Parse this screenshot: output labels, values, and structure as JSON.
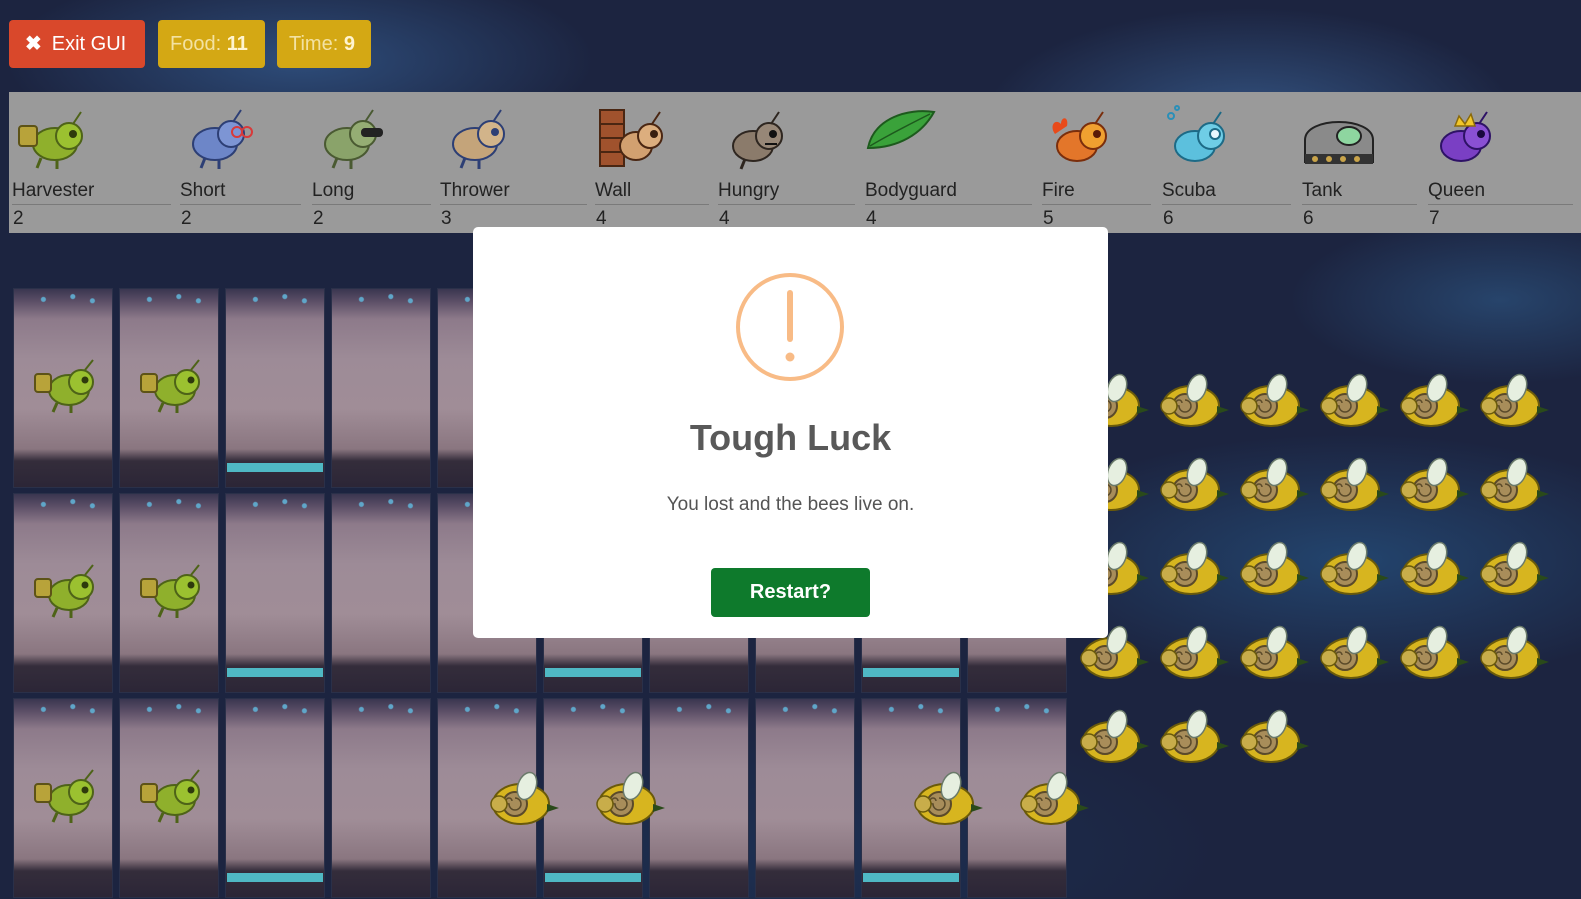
{
  "top_bar": {
    "exit_label": "Exit GUI",
    "food_label": "Food:",
    "food_value": "11",
    "time_label": "Time:",
    "time_value": "9"
  },
  "ants": [
    {
      "name": "Harvester",
      "cost": "2",
      "icon": "harvester-ant-icon",
      "color": "#8fb02c"
    },
    {
      "name": "Short",
      "cost": "2",
      "icon": "short-thrower-ant-icon",
      "color": "#6d86c8"
    },
    {
      "name": "Long",
      "cost": "2",
      "icon": "long-thrower-ant-icon",
      "color": "#8aa36a"
    },
    {
      "name": "Thrower",
      "cost": "3",
      "icon": "thrower-ant-icon",
      "color": "#c4a47a"
    },
    {
      "name": "Wall",
      "cost": "4",
      "icon": "wall-ant-icon",
      "color": "#a0522d"
    },
    {
      "name": "Hungry",
      "cost": "4",
      "icon": "hungry-ant-icon",
      "color": "#8b7b6b"
    },
    {
      "name": "Bodyguard",
      "cost": "4",
      "icon": "bodyguard-leaf-icon",
      "color": "#3aa23a"
    },
    {
      "name": "Fire",
      "cost": "5",
      "icon": "fire-ant-icon",
      "color": "#e3762a"
    },
    {
      "name": "Scuba",
      "cost": "6",
      "icon": "scuba-ant-icon",
      "color": "#5cc0dd"
    },
    {
      "name": "Tank",
      "cost": "6",
      "icon": "tank-ant-icon",
      "color": "#8a8a8a"
    },
    {
      "name": "Queen",
      "cost": "7",
      "icon": "queen-ant-icon",
      "color": "#7a3fc4"
    }
  ],
  "modal": {
    "title": "Tough Luck",
    "message": "You lost and the bees live on.",
    "button_label": "Restart?",
    "icon": "warning-icon",
    "icon_color": "#f8bb86",
    "button_color": "#0e7a2c"
  },
  "colors": {
    "exit_button": "#d9482b",
    "badge": "#d4a814",
    "bee": "#d7b51f"
  }
}
